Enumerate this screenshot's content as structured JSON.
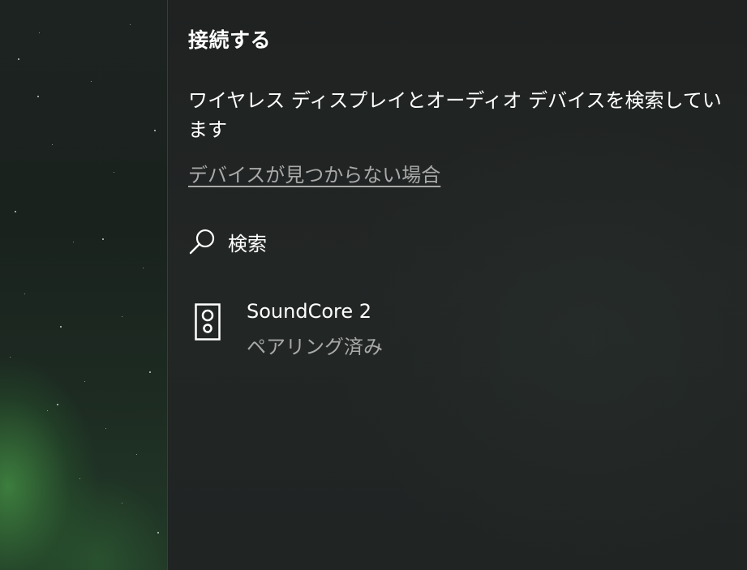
{
  "panel": {
    "title": "接続する",
    "status": "ワイヤレス ディスプレイとオーディオ デバイスを検索しています",
    "help_link": "デバイスが見つからない場合",
    "search": {
      "label": "検索",
      "icon": "search-icon"
    },
    "devices": [
      {
        "name": "SoundCore 2",
        "status": "ペアリング済み",
        "icon": "speaker-icon"
      }
    ]
  },
  "colors": {
    "panel_background": "#202423",
    "primary_text": "#ffffff",
    "secondary_text": "#a9a9a9",
    "aurora_green": "#3c8a44"
  }
}
